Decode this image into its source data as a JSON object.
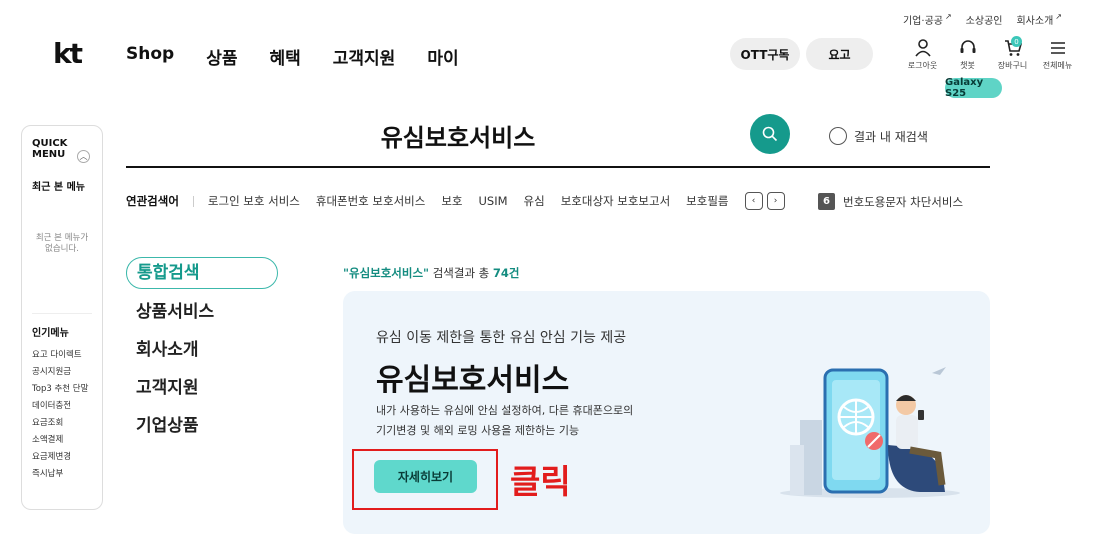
{
  "util_links": [
    "기업·공공",
    "소상공인",
    "회사소개"
  ],
  "logo": "kt",
  "gnb": [
    "Shop",
    "상품",
    "혜택",
    "고객지원",
    "마이"
  ],
  "pills": {
    "ott": "OTT구독",
    "plan": "요고"
  },
  "header_icons": [
    {
      "label": "로그아웃",
      "icon": "user-icon"
    },
    {
      "label": "챗봇",
      "icon": "chatbot-icon"
    },
    {
      "label": "장바구니",
      "icon": "cart-icon"
    },
    {
      "label": "전체메뉴",
      "icon": "menu-icon"
    }
  ],
  "cart_count": "0",
  "galaxy_badge": "Galaxy S25",
  "quick_menu": {
    "title": "QUICK MENU",
    "recent_heading": "최근 본 메뉴",
    "recent_empty": "최근 본 메뉴가 없습니다.",
    "popular_heading": "인기메뉴",
    "popular_items": [
      "요고 다이렉트",
      "공시지원금",
      "Top3 추천 단말",
      "데이터충전",
      "요금조회",
      "소액결제",
      "요금제변경",
      "즉시납부"
    ]
  },
  "search": {
    "term": "유심보호서비스",
    "within_label": "결과 내 재검색"
  },
  "related": {
    "label": "연관검색어",
    "keywords": [
      "로그인 보호 서비스",
      "휴대폰번호 보호서비스",
      "보호",
      "USIM",
      "유심",
      "보호대상자 보호보고서",
      "보호필름"
    ],
    "rank_num": "6",
    "rank_text": "번호도용문자 차단서비스"
  },
  "categories": [
    "통합검색",
    "상품서비스",
    "회사소개",
    "고객지원",
    "기업상품"
  ],
  "summary": {
    "query": "\"유심보호서비스\"",
    "text": "검색결과 총",
    "count": "74건"
  },
  "result_card": {
    "subtitle": "유심 이동 제한을 통한 유심 안심 기능 제공",
    "title": "유심보호서비스",
    "desc_line1": "내가 사용하는 유심에 안심 설정하여, 다른 휴대폰으로의",
    "desc_line2": "기기변경 및 해외 로밍 사용을 제한하는 기능",
    "button": "자세히보기"
  },
  "annotation": "클릭",
  "colors": {
    "accent": "#159a8c",
    "accent_light": "#5fd8cc",
    "highlight": "#e21c1c",
    "card_bg": "#eef5fb"
  }
}
